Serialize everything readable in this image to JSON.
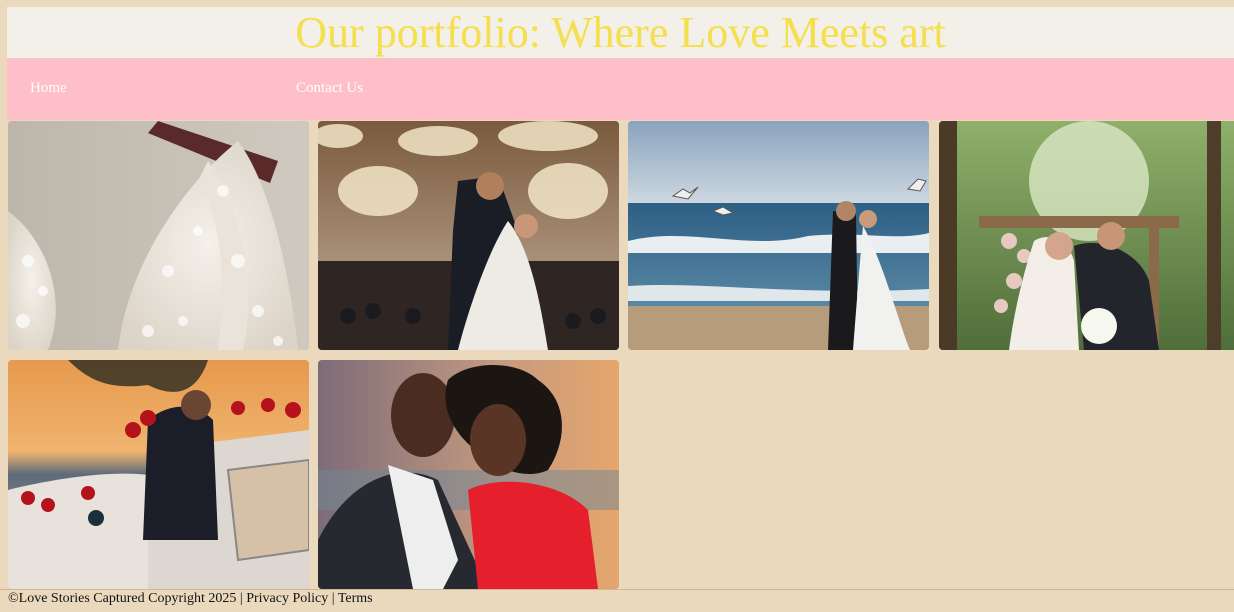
{
  "header": {
    "title": "Our portfolio: Where Love Meets art"
  },
  "nav": {
    "items": [
      {
        "label": "Home"
      },
      {
        "label": "Contact Us"
      }
    ]
  },
  "gallery": {
    "images": [
      {
        "subject": "lace wedding dress on hanger"
      },
      {
        "subject": "couple dancing in chandelier ballroom"
      },
      {
        "subject": "couple kissing on beach with seagulls"
      },
      {
        "subject": "couple under floral arch in forest"
      },
      {
        "subject": "groom in vintage car with roses at sunset"
      },
      {
        "subject": "couple embracing at sunset"
      }
    ]
  },
  "footer": {
    "copyright": "©Love Stories Captured Copyright 2025",
    "separator1": " | ",
    "privacy": "Privacy Policy",
    "separator2": " | ",
    "terms": "Terms"
  },
  "colors": {
    "page_background": "#ead9bd",
    "header_background": "#f3efe9",
    "title_color": "#f5df4d",
    "nav_background": "#ffbfc9",
    "nav_text": "#ffffff"
  }
}
